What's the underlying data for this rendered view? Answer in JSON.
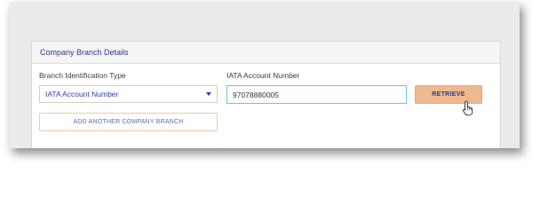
{
  "panel": {
    "title": "Company Branch Details"
  },
  "branch_type": {
    "label": "Branch Identification Type",
    "selected": "IATA Account Number"
  },
  "iata_account": {
    "label": "IATA Account Number",
    "value": "97078880005"
  },
  "buttons": {
    "retrieve": "RETRIEVE",
    "add_branch": "ADD ANOTHER COMPANY BRANCH"
  },
  "icons": {
    "dropdown": "chevron-down-icon",
    "cursor": "hand-pointer-icon"
  },
  "colors": {
    "accent_text": "#2b3a8c",
    "retrieve_bg": "#efb98f",
    "input_focus_border": "#66c7e3"
  }
}
